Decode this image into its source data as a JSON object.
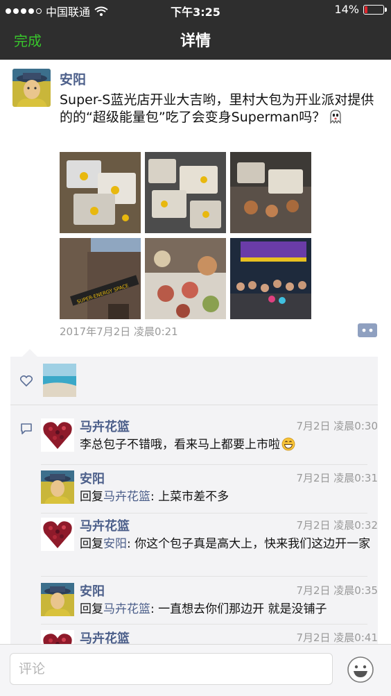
{
  "status_bar": {
    "carrier": "中国联通",
    "time": "下午3:25",
    "battery_percent": "14%",
    "battery_level": 0.14,
    "battery_color": "#e0242b"
  },
  "nav": {
    "done_label": "完成",
    "title": "详情"
  },
  "post": {
    "author": "安阳",
    "text": "Super-S蓝光店开业大吉哟，里村大包为开业派对提供的的“超级能量包”吃了会变身Superman吗？",
    "emoji": "ghost-icon",
    "photo_count": 6,
    "time": "2017年7月2日 凌晨0:21"
  },
  "likes": {
    "icon": "heart-icon"
  },
  "comments": [
    {
      "name": "马卉花篮",
      "time": "7月2日 凌晨0:30",
      "reply_to": "",
      "text": "李总包子不错哦，看来马上都要上市啦",
      "avatar": "heart-avatar",
      "emoji": "grin-icon"
    },
    {
      "name": "安阳",
      "time": "7月2日 凌晨0:31",
      "reply_prefix": "回复",
      "reply_to": "马卉花篮",
      "text": ": 上菜市差不多",
      "avatar": "man-avatar"
    },
    {
      "name": "马卉花篮",
      "time": "7月2日 凌晨0:32",
      "reply_prefix": "回复",
      "reply_to": "安阳",
      "text": ": 你这个包子真是高大上，快来我们这边开一家",
      "avatar": "heart-avatar"
    },
    {
      "name": "安阳",
      "time": "7月2日 凌晨0:35",
      "reply_prefix": "回复",
      "reply_to": "马卉花篮",
      "text": ": 一直想去你们那边开 就是没铺子",
      "avatar": "man-avatar"
    },
    {
      "name": "马卉花篮",
      "time": "7月2日 凌晨0:41",
      "avatar": "heart-avatar"
    }
  ],
  "input": {
    "placeholder": "评论"
  },
  "colors": {
    "bar_bg": "#2e2e2e",
    "accent_green": "#38c52c",
    "name_blue": "#4c5f8a",
    "feedback_bg": "#f3f3f5"
  }
}
